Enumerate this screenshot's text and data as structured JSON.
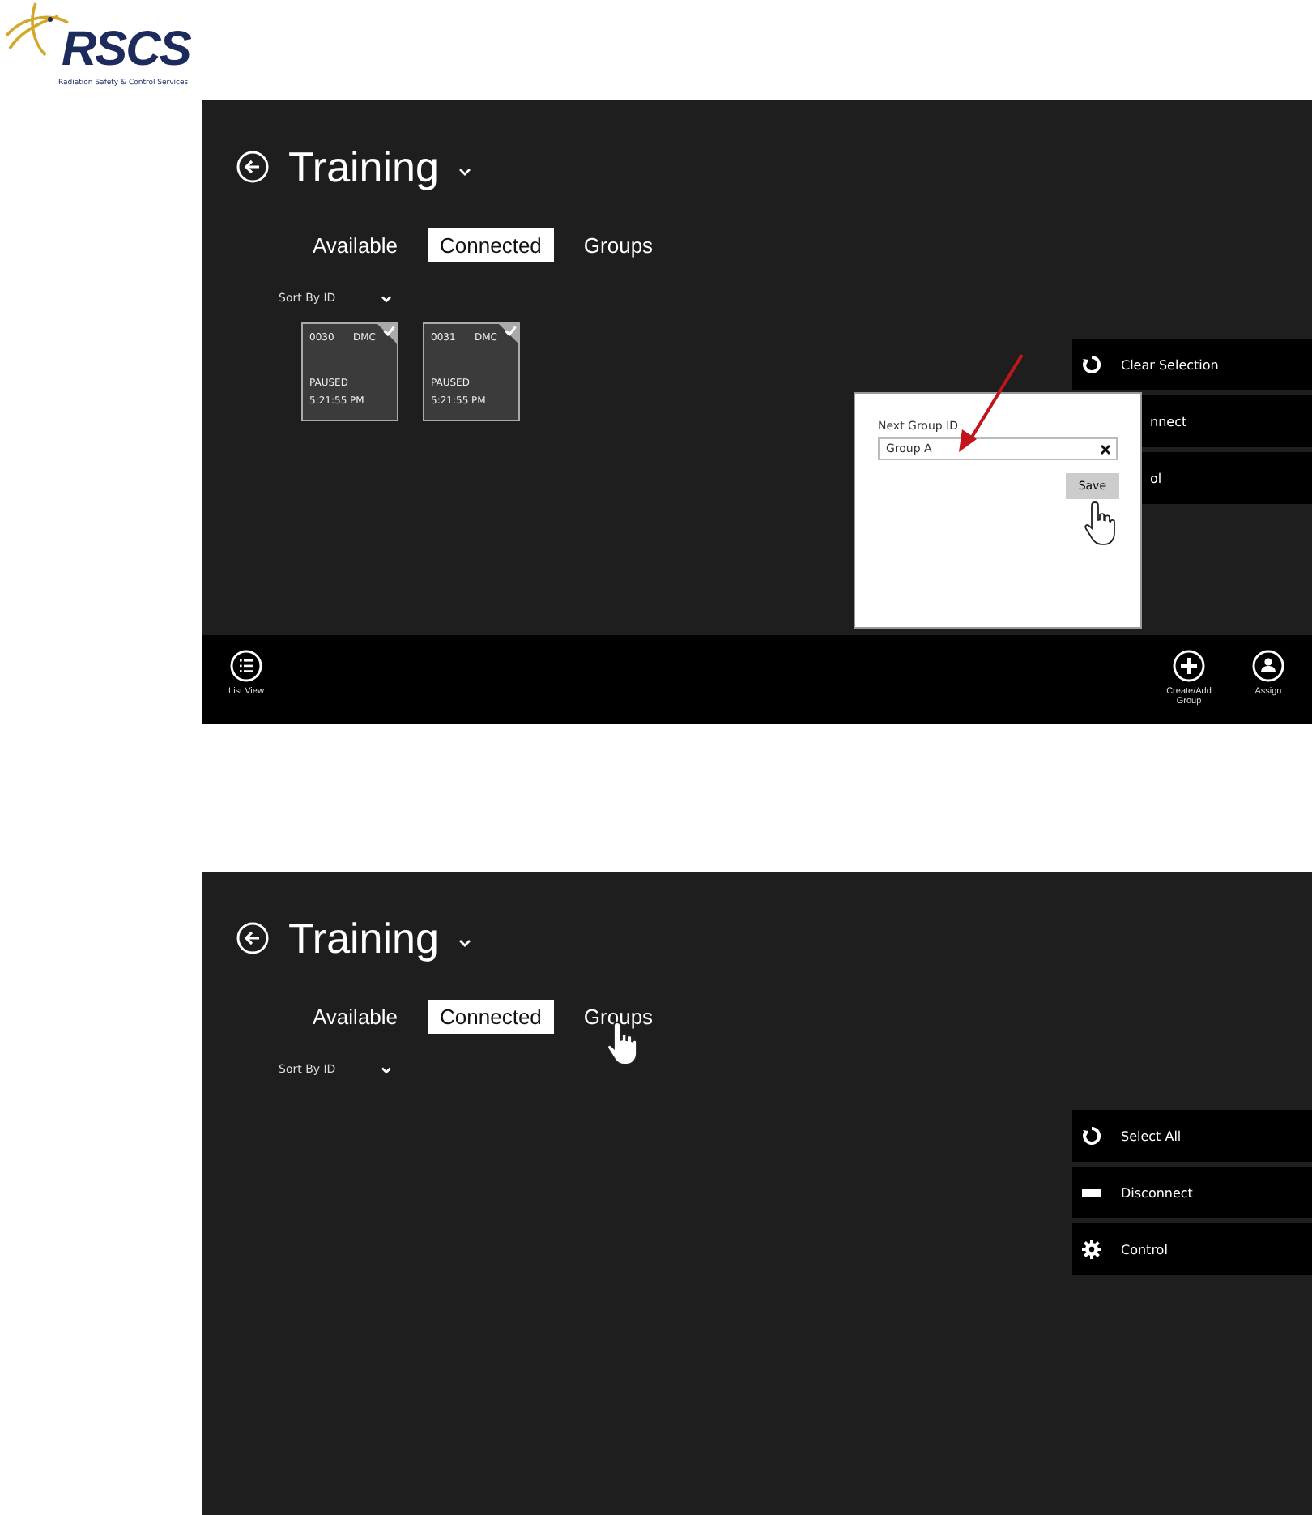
{
  "logo": {
    "name": "RSCS",
    "tagline": "Radiation Safety & Control Services"
  },
  "screens": [
    {
      "title": "Training",
      "tabs": [
        {
          "label": "Available",
          "selected": false,
          "pointed": false
        },
        {
          "label": "Connected",
          "selected": true,
          "pointed": false
        },
        {
          "label": "Groups",
          "selected": false,
          "pointed": false
        }
      ],
      "sort": "Sort By ID",
      "tiles": [
        {
          "id": "0030",
          "type": "DMC",
          "status": "PAUSED",
          "time": "5:21:55 PM",
          "selected": true
        },
        {
          "id": "0031",
          "type": "DMC",
          "status": "PAUSED",
          "time": "5:21:55 PM",
          "selected": true
        }
      ],
      "menu": [
        {
          "kind": "refresh",
          "label": "Clear Selection"
        },
        {
          "kind": "covered",
          "label": "nnect"
        },
        {
          "kind": "covered",
          "label": "ol"
        }
      ],
      "dialog": {
        "label": "Next Group ID",
        "value": "Group A",
        "save": "Save",
        "pointed": true
      },
      "app_bar": [
        {
          "kind": "list",
          "label": "List View"
        },
        {
          "kind": "spacer"
        },
        {
          "kind": "plus",
          "label": "Create/Add Group"
        },
        {
          "kind": "person",
          "label": "Assign"
        }
      ]
    },
    {
      "title": "Training",
      "tabs": [
        {
          "label": "Available",
          "selected": false,
          "pointed": false
        },
        {
          "label": "Connected",
          "selected": true,
          "pointed": false
        },
        {
          "label": "Groups",
          "selected": false,
          "pointed": true
        }
      ],
      "sort": "Sort By ID",
      "menu": [
        {
          "kind": "refresh",
          "label": "Select All"
        },
        {
          "kind": "minus",
          "label": "Disconnect"
        },
        {
          "kind": "gear",
          "label": "Control"
        }
      ]
    }
  ]
}
